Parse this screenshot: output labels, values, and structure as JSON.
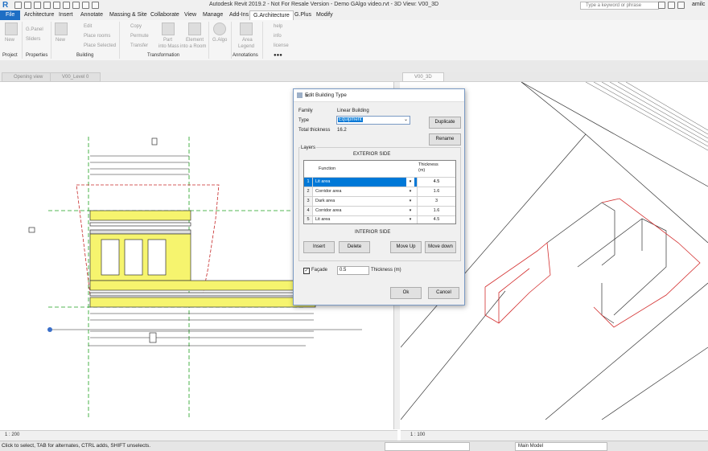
{
  "app": {
    "title": "Autodesk Revit 2019.2 - Not For Resale Version - Demo GAlgo video.rvt - 3D View: V00_3D",
    "search_placeholder": "Type a keyword or phrase",
    "user": "amilc"
  },
  "tabs": [
    "File",
    "Architecture",
    "Insert",
    "Annotate",
    "Massing & Site",
    "Collaborate",
    "View",
    "Manage",
    "Add-Ins",
    "G.Architecture",
    "G.Plus",
    "Modify"
  ],
  "ribbon": {
    "project": {
      "new": "New",
      "panel": "Project"
    },
    "properties": {
      "gpanel": "G.Panel",
      "sliders": "Sliders",
      "panel": "Properties"
    },
    "building": {
      "new": "New",
      "edit": "Edit",
      "place_rooms": "Place rooms",
      "place_selected": "Place Selected",
      "panel": "Building"
    },
    "transformation": {
      "copy": "Copy",
      "permute": "Permute",
      "transfer": "Transfer",
      "part": "Part",
      "into_mass": "into Mass",
      "element": "Element",
      "into_room": "into a Room",
      "panel": "Transformation"
    },
    "galgo": {
      "label": "G.Algo"
    },
    "annotations": {
      "area": "Area",
      "legend": "Legend",
      "panel": "Annotations"
    },
    "help": {
      "help": "help",
      "info": "info",
      "license": "license",
      "more": "●●●"
    }
  },
  "view_tabs": [
    "Opening view",
    "V00_Level 0",
    "V00_3D"
  ],
  "left_view": {
    "scale": "1 : 200"
  },
  "right_view": {
    "scale": "1 : 100"
  },
  "status": {
    "message": "Click to select, TAB for alternates, CTRL adds, SHIFT unselects.",
    "model": "Main Model"
  },
  "dialog": {
    "title": "Edit Building Type",
    "family_label": "Family",
    "family_value": "Linear Building",
    "type_label": "Type",
    "type_value": "Equipment",
    "total_label": "Total thickness",
    "total_value": "16.2",
    "duplicate": "Duplicate",
    "rename": "Rename",
    "layers_label": "Layers",
    "exterior": "EXTERIOR SIDE",
    "interior": "INTERIOR SIDE",
    "col_function": "Function",
    "col_thickness": "Thickness\n(m)",
    "rows": [
      {
        "n": "1",
        "function": "Lit area",
        "thickness": "4.5",
        "dd": "▾"
      },
      {
        "n": "2",
        "function": "Corridor area",
        "thickness": "1.6",
        "dd": "▾"
      },
      {
        "n": "3",
        "function": "Dark area",
        "thickness": "3",
        "dd": "▾"
      },
      {
        "n": "4",
        "function": "Corridor area",
        "thickness": "1.6",
        "dd": "▾"
      },
      {
        "n": "5",
        "function": "Lit area",
        "thickness": "4.5",
        "dd": "▾"
      }
    ],
    "insert": "Insert",
    "delete": "Delete",
    "move_up": "Move Up",
    "move_down": "Move down",
    "facade_label": "Façade",
    "facade_value": "0.5",
    "facade_thickness_label": "Thickness (m)",
    "ok": "Ok",
    "cancel": "Cancel"
  }
}
